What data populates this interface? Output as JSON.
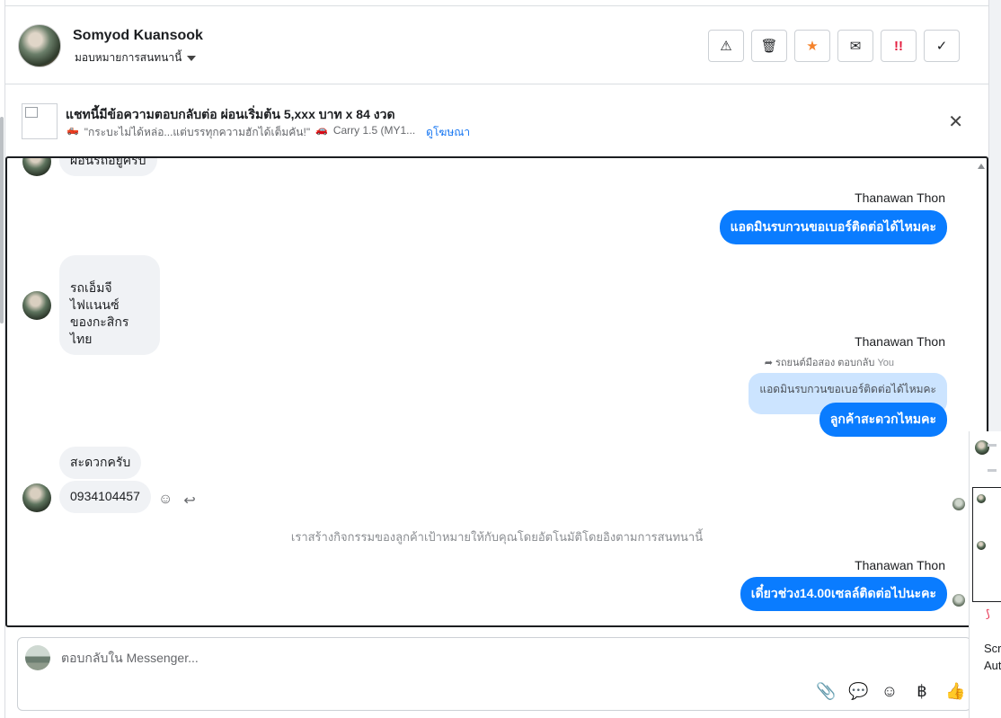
{
  "header": {
    "user_name": "Somyod Kuansook",
    "assign_label": "มอบหมายการสนทนานี้",
    "actions": [
      {
        "name": "report-spam-button",
        "icon": "⚠"
      },
      {
        "name": "delete-button",
        "icon": "🗑"
      },
      {
        "name": "star-button",
        "icon": "★"
      },
      {
        "name": "mark-unread-button",
        "icon": "✉"
      },
      {
        "name": "follow-up-button",
        "icon": "!!"
      },
      {
        "name": "mark-done-button",
        "icon": "✓"
      }
    ]
  },
  "ad": {
    "title": "แชทนี้มีข้อความตอบกลับต่อ ผ่อนเริ่มต้น 5,xxx บาท x 84 งวด",
    "subtitle_1": "\"กระบะไม่ได้หล่อ...แต่บรรทุกความฮักได้เต็มคัน!\"",
    "subtitle_2": "Carry 1.5 (MY1...",
    "link": "ดูโฆษณา",
    "close": "✕"
  },
  "chat": {
    "messages_in": [
      {
        "text": "ผ่อนรถอยู่ครับ"
      },
      {
        "text": "รถเอ็มจี\nไฟแนนซ์\nของกะสิกรไทย"
      },
      {
        "text": "สะดวกครับ"
      },
      {
        "text": "0934104457"
      }
    ],
    "messages_out": [
      {
        "sender": "Thanawan Thon",
        "text": "แอดมินรบกวนขอเบอร์ติดต่อได้ไหมคะ"
      },
      {
        "sender": "Thanawan Thon",
        "reply_note": "รถยนต์มือสอง ตอบกลับ",
        "reply_to": "You",
        "quoted": "แอดมินรบกวนขอเบอร์ติดต่อได้ไหมคะ",
        "text": "ลูกค้าสะดวกไหมคะ"
      },
      {
        "sender": "Thanawan Thon",
        "text": "เดี๋ยวช่วง14.00เซลล์ติดต่อไปนะคะ"
      }
    ],
    "system_message": "เราสร้างกิจกรรมของลูกค้าเป้าหมายให้กับคุณโดยอัตโนมัติโดยอิงตามการสนทนานี้"
  },
  "composer": {
    "placeholder": "ตอบกลับใน Messenger...",
    "tools": [
      {
        "name": "attach-icon",
        "glyph": "📎"
      },
      {
        "name": "saved-reply-icon",
        "glyph": "💬"
      },
      {
        "name": "emoji-icon",
        "glyph": "☺"
      },
      {
        "name": "payment-icon",
        "glyph": "฿"
      },
      {
        "name": "like-icon",
        "glyph": "👍"
      }
    ]
  },
  "side_peek": {
    "text_1": "Scr",
    "text_2": "Aut"
  },
  "colors": {
    "accent": "#0a7cff",
    "bubble_in": "#f0f2f5",
    "quote_bg": "#cce4ff"
  }
}
